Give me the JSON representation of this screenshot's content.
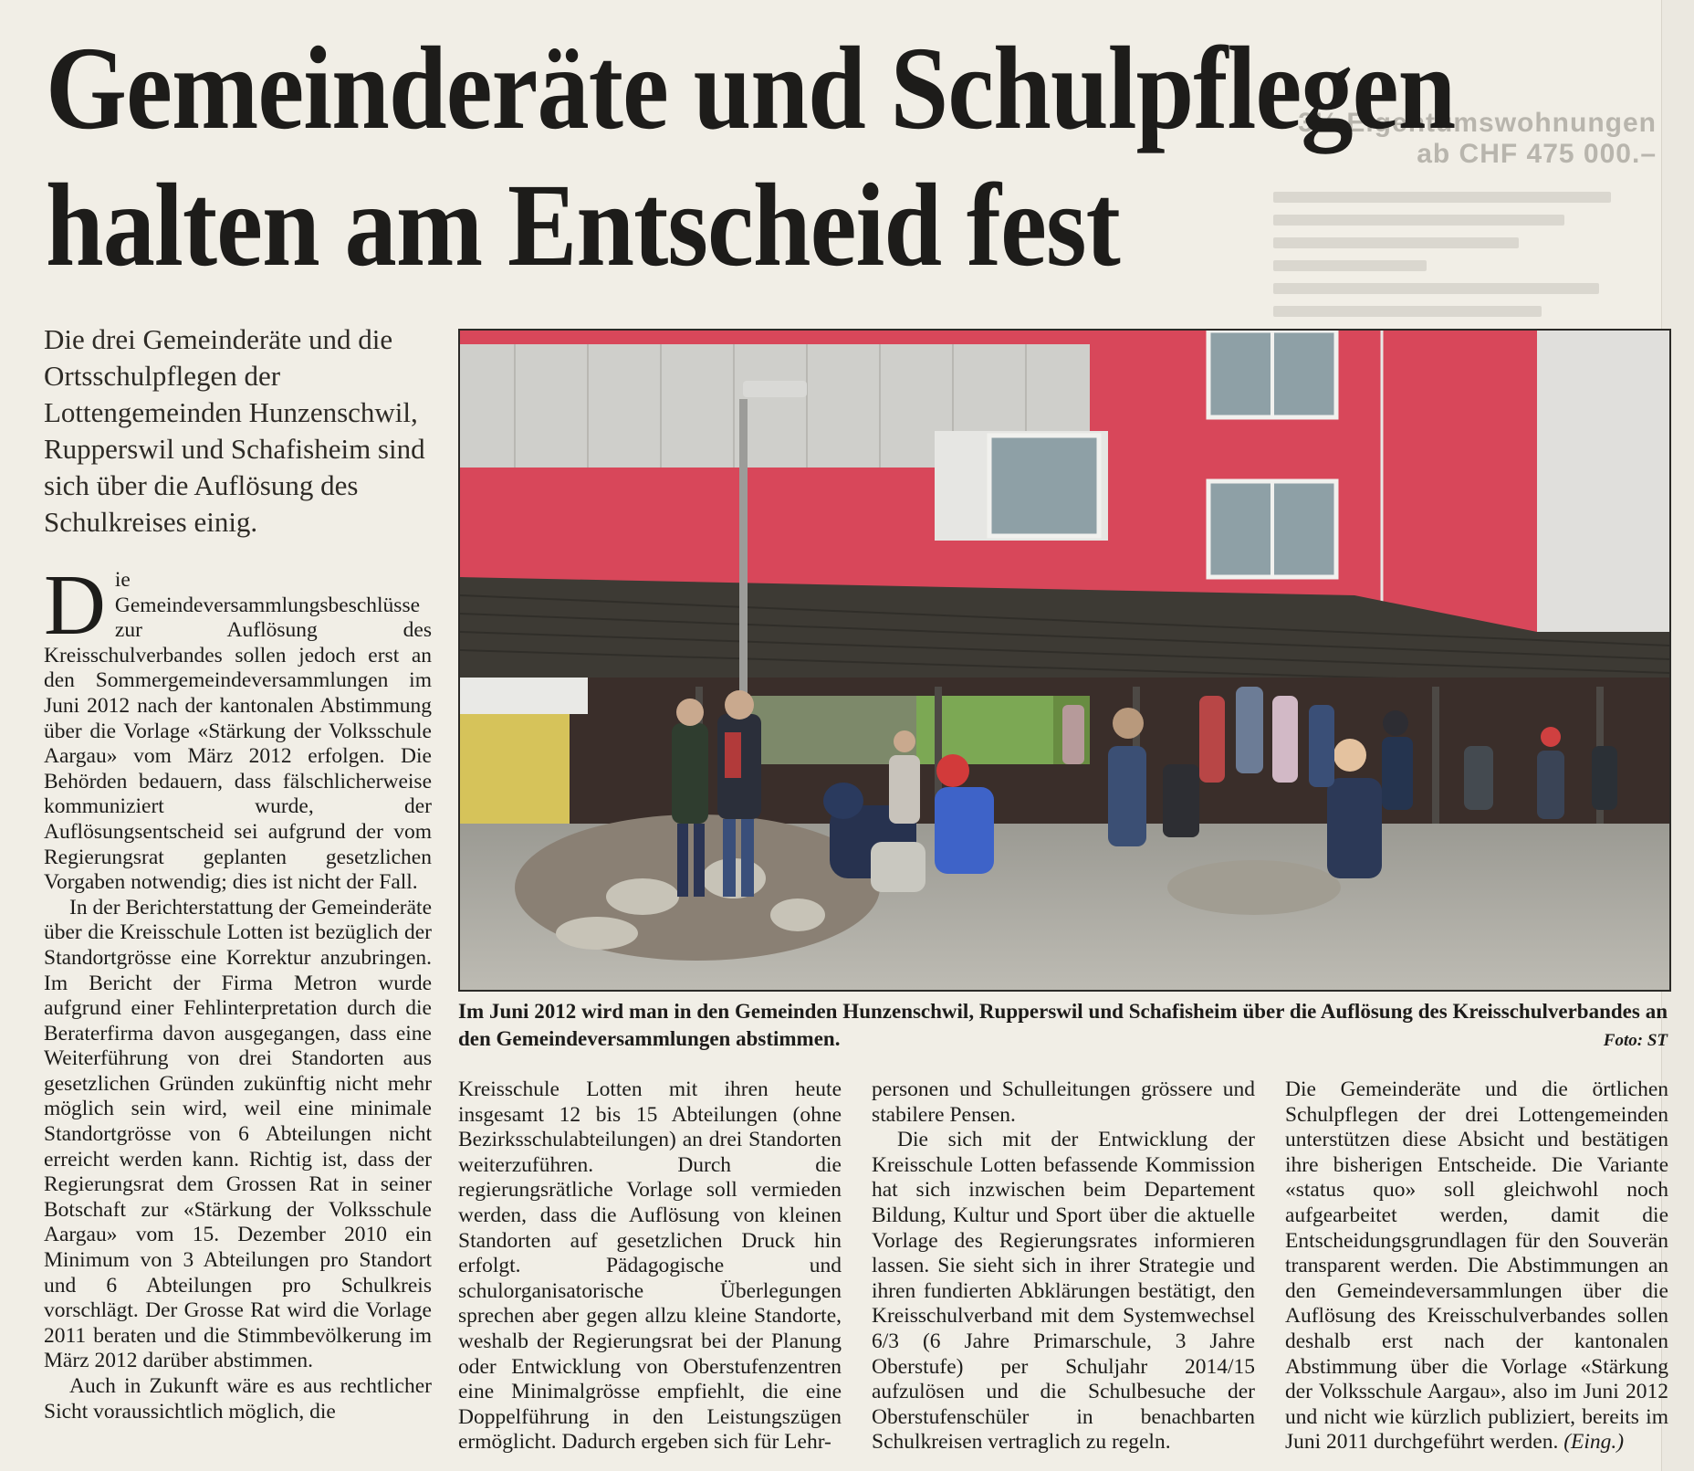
{
  "headline": {
    "line1": "Gemeinderäte und Schulpflegen",
    "line2": "halten am Entscheid fest"
  },
  "lead": "Die drei Gemeinderäte und die Ortsschulpflegen der Lottengemeinden Hunzenschwil, Rupperswil und Schafisheim sind sich über die Auflösung des Schulkreises einig.",
  "body": {
    "dropcap": "D",
    "col1_p1": "ie Gemeindeversammlungsbeschlüsse zur Auflösung des Kreisschulverbandes sollen jedoch erst an den Sommergemeindeversammlungen im Juni 2012 nach der kantonalen Abstimmung über die Vorlage «Stärkung der Volksschule Aargau» vom März 2012 erfolgen. Die Behörden bedauern, dass fälschlicherweise kommuniziert wurde, der Auflösungsentscheid sei aufgrund der vom Regierungsrat geplanten gesetzlichen Vorgaben notwendig; dies ist nicht der Fall.",
    "col1_p2": "In der Berichterstattung der Gemeinderäte über die Kreisschule Lotten ist bezüglich der Standortgrösse eine Korrektur anzubringen. Im Bericht der Firma Metron wurde aufgrund einer Fehlinterpretation durch die Beraterfirma davon ausgegangen, dass eine Weiterführung von drei Standorten aus gesetzlichen Gründen zukünftig nicht mehr möglich sein wird, weil eine minimale Standortgrösse von 6 Abteilungen nicht erreicht werden kann. Richtig ist, dass der Regierungsrat dem Grossen Rat in seiner Botschaft zur «Stärkung der Volksschule Aargau» vom 15. Dezember 2010 ein Minimum von 3 Abteilungen pro Standort und 6 Abteilungen pro Schulkreis vorschlägt. Der Grosse Rat wird die Vorlage 2011 beraten und die Stimmbevölkerung im März 2012 darüber abstimmen.",
    "col1_p3": "Auch in Zukunft wäre es aus rechtlicher Sicht voraussichtlich möglich, die",
    "col2": "Kreisschule Lotten mit ihren heute insgesamt 12 bis 15 Abteilungen (ohne Bezirksschulabteilungen) an drei Standorten weiterzuführen. Durch die regierungsrätliche Vorlage soll vermieden werden, dass die Auflösung von kleinen Standorten auf gesetzlichen Druck hin erfolgt. Pädagogische und schulorganisatorische Überlegungen sprechen aber gegen allzu kleine Standorte, weshalb der Regierungsrat bei der Planung oder Entwicklung von Oberstufenzentren eine Minimalgrösse empfiehlt, die eine Doppelführung in den Leistungszügen ermöglicht. Dadurch ergeben sich für Lehr-",
    "col3_p1": "personen und Schulleitungen grössere und stabilere Pensen.",
    "col3_p2": "Die sich mit der Entwicklung der Kreisschule Lotten befassende Kommission hat sich inzwischen beim Departement Bildung, Kultur und Sport über die aktuelle Vorlage des Regierungsrates informieren lassen. Sie sieht sich in ihrer Strategie und ihren fundierten Abklärungen bestätigt, den Kreisschulverband mit dem Systemwechsel 6/3 (6 Jahre Primarschule, 3 Jahre Oberstufe) per Schuljahr 2014/15 aufzulösen und die Schulbesuche der Oberstufenschüler in benachbarten Schulkreisen vertraglich zu regeln.",
    "col4": "Die Gemeinderäte und die örtlichen Schulpflegen der drei Lottengemeinden unterstützen diese Absicht und bestätigen ihre bisherigen Entscheide. Die Variante «status quo» soll gleichwohl noch aufgearbeitet werden, damit die Entscheidungsgrundlagen für den Souverän transparent werden. Die Abstimmungen an den Gemeindeversammlungen über die Auflösung des Kreisschulverbandes sollen deshalb erst nach der kantonalen Abstimmung über die Vorlage «Stärkung der Volksschule Aargau», also im Juni 2012 und nicht wie kürzlich publiziert, bereits im Juni 2011 durchgeführt werden.",
    "col4_sign": "(Eing.)"
  },
  "caption": {
    "bold": "Im Juni 2012",
    "text": " wird man in den Gemeinden Hunzenschwil, Rupperswil und Schafisheim über die Auflösung des Kreisschulverbandes an den Gemeindeversammlungen abstimmen.",
    "credit": "Foto: ST"
  },
  "photo": {
    "wall_color": "#d8475a",
    "roof_color": "#3d3a34"
  },
  "faded_ad": {
    "text": "3½ Eigentumswohnungen ab CHF 475 000.–"
  }
}
